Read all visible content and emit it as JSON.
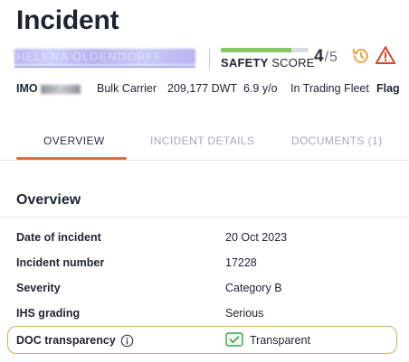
{
  "page_title": "Incident",
  "vessel": {
    "name_blurred": "HELENA OLDENDORFF"
  },
  "safety": {
    "label_strong": "SAFETY",
    "label_rest": " SCORE",
    "score": "4",
    "separator": "/",
    "max": "5",
    "fill_fraction": 0.8,
    "fill_color": "#86c665",
    "icons": [
      "history-icon",
      "warning-icon"
    ]
  },
  "meta": {
    "imo_label": "IMO",
    "vessel_type": "Bulk Carrier",
    "dwt": "209,177 DWT",
    "age": "6.9 y/o",
    "status": "In Trading Fleet",
    "flag_label": "Flag"
  },
  "tabs": [
    {
      "label": "OVERVIEW",
      "active": true
    },
    {
      "label": "INCIDENT DETAILS",
      "active": false
    },
    {
      "label": "DOCUMENTS (1)",
      "active": false
    }
  ],
  "overview": {
    "title": "Overview",
    "rows": [
      {
        "label": "Date of incident",
        "value": "20 Oct 2023"
      },
      {
        "label": "Incident number",
        "value": "17228"
      },
      {
        "label": "Severity",
        "value": "Category B"
      },
      {
        "label": "IHS grading",
        "value": "Serious"
      },
      {
        "label": "DOC transparency",
        "value": "Transparent"
      }
    ]
  },
  "colors": {
    "accent_tab": "#e06b45",
    "highlight_border": "#c9b257",
    "check_green": "#3fa34d",
    "warning_red": "#d9462b",
    "history_amber": "#e3a13a"
  }
}
